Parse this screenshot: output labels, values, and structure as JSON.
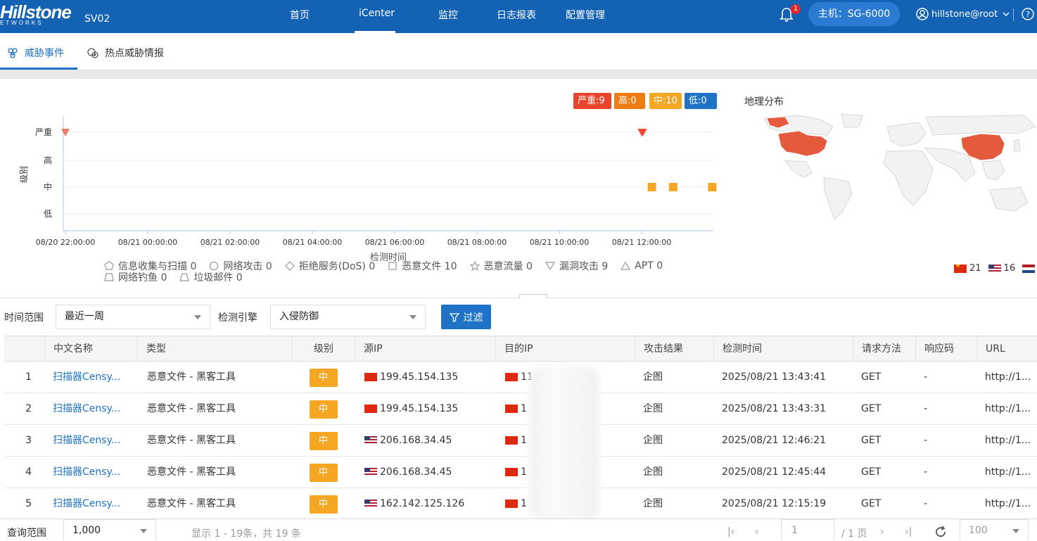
{
  "header": {
    "brand": "Hillstone",
    "brand_sub": "ETWORKS",
    "device": "SV02",
    "nav": [
      "首页",
      "iCenter",
      "监控",
      "日志报表",
      "配置管理"
    ],
    "active_nav": "iCenter",
    "bell_count": "1",
    "host": "主机：SG-6000",
    "user": "hillstone@root"
  },
  "tabs": [
    {
      "label": "威胁事件",
      "active": true
    },
    {
      "label": "热点威胁情报",
      "active": false
    }
  ],
  "severity_badges": [
    {
      "label": "严重:9",
      "color": "#e8452c"
    },
    {
      "label": "高:0",
      "color": "#f07c11"
    },
    {
      "label": "中:10",
      "color": "#f5a623"
    },
    {
      "label": "低:0",
      "color": "#1e73c7"
    }
  ],
  "geo": {
    "title": "地理分布",
    "legend": [
      {
        "flag": "cn",
        "count": "21"
      },
      {
        "flag": "us",
        "count": "16"
      },
      {
        "flag": "nl",
        "count": ""
      }
    ]
  },
  "chart_data": {
    "type": "scatter",
    "ylabel": "级别",
    "xlabel": "检测时间",
    "y_categories": [
      "低",
      "中",
      "高",
      "严重"
    ],
    "x_ticks": [
      "08/20 22:00:00",
      "08/21 00:00:00",
      "08/21 02:00:00",
      "08/21 04:00:00",
      "08/21 06:00:00",
      "08/21 08:00:00",
      "08/21 10:00:00",
      "08/21 12:00:00"
    ],
    "x_range": [
      "08/20 22:00",
      "08/21 13:43"
    ],
    "grid": true,
    "series": [
      {
        "name": "漏洞攻击",
        "color": "#e8452c",
        "marker": "triangle-down",
        "points": [
          {
            "x": "08/20 22:00",
            "y": "严重"
          },
          {
            "x": "08/21 12:00",
            "y": "严重"
          },
          {
            "x": "08/21 12:01",
            "y": "严重"
          },
          {
            "x": "08/21 12:02",
            "y": "严重"
          }
        ]
      },
      {
        "name": "恶意文件",
        "color": "#f5a623",
        "marker": "square",
        "points": [
          {
            "x": "08/21 12:15",
            "y": "中"
          },
          {
            "x": "08/21 12:46",
            "y": "中"
          },
          {
            "x": "08/21 13:43",
            "y": "中"
          }
        ]
      }
    ],
    "legend": [
      {
        "label": "信息收集与扫描 0",
        "shape": "pentagon"
      },
      {
        "label": "网络攻击 0",
        "shape": "circle"
      },
      {
        "label": "拒绝服务(DoS) 0",
        "shape": "diamond"
      },
      {
        "label": "恶意文件 10",
        "shape": "square"
      },
      {
        "label": "恶意流量 0",
        "shape": "star"
      },
      {
        "label": "漏洞攻击 9",
        "shape": "triangle-down"
      },
      {
        "label": "APT 0",
        "shape": "triangle-up"
      },
      {
        "label": "网络钓鱼 0",
        "shape": "trapezoid"
      },
      {
        "label": "垃圾邮件 0",
        "shape": "trapezoid2"
      }
    ]
  },
  "filters": {
    "time_label": "时间范围",
    "time_value": "最近一周",
    "engine_label": "检测引擎",
    "engine_value": "入侵防御",
    "filter_button": "过滤"
  },
  "table": {
    "columns": [
      "",
      "中文名称",
      "类型",
      "级别",
      "源IP",
      "目的IP",
      "攻击结果",
      "检测时间",
      "请求方法",
      "响应码",
      "URL"
    ],
    "rows": [
      {
        "idx": "1",
        "name": "扫描器Censy...",
        "type": "恶意文件 - 黑客工具",
        "level": "中",
        "src_flag": "hk",
        "src": "199.45.154.135",
        "dst_flag": "cn",
        "dst": "11",
        "result": "企图",
        "time": "2025/08/21 13:43:41",
        "method": "GET",
        "code": "-",
        "url": "http://1..."
      },
      {
        "idx": "2",
        "name": "扫描器Censy...",
        "type": "恶意文件 - 黑客工具",
        "level": "中",
        "src_flag": "hk",
        "src": "199.45.154.135",
        "dst_flag": "cn",
        "dst": "1",
        "result": "企图",
        "time": "2025/08/21 13:43:31",
        "method": "GET",
        "code": "-",
        "url": "http://1..."
      },
      {
        "idx": "3",
        "name": "扫描器Censy...",
        "type": "恶意文件 - 黑客工具",
        "level": "中",
        "src_flag": "us",
        "src": "206.168.34.45",
        "dst_flag": "cn",
        "dst": "1",
        "result": "企图",
        "time": "2025/08/21 12:46:21",
        "method": "GET",
        "code": "-",
        "url": "http://1..."
      },
      {
        "idx": "4",
        "name": "扫描器Censy...",
        "type": "恶意文件 - 黑客工具",
        "level": "中",
        "src_flag": "us",
        "src": "206.168.34.45",
        "dst_flag": "cn",
        "dst": "1",
        "result": "企图",
        "time": "2025/08/21 12:45:44",
        "method": "GET",
        "code": "-",
        "url": "http://1..."
      },
      {
        "idx": "5",
        "name": "扫描器Censy...",
        "type": "恶意文件 - 黑客工具",
        "level": "中",
        "src_flag": "us",
        "src": "162.142.125.126",
        "dst_flag": "cn",
        "dst": "1",
        "result": "企图",
        "time": "2025/08/21 12:15:19",
        "method": "GET",
        "code": "-",
        "url": "http://1..."
      }
    ]
  },
  "footer": {
    "range_label": "查询范围",
    "range_value": "1,000",
    "summary": "显示 1 - 19条，共 19 条",
    "page_input": "1",
    "page_total": "/ 1 页",
    "page_size": "100"
  }
}
